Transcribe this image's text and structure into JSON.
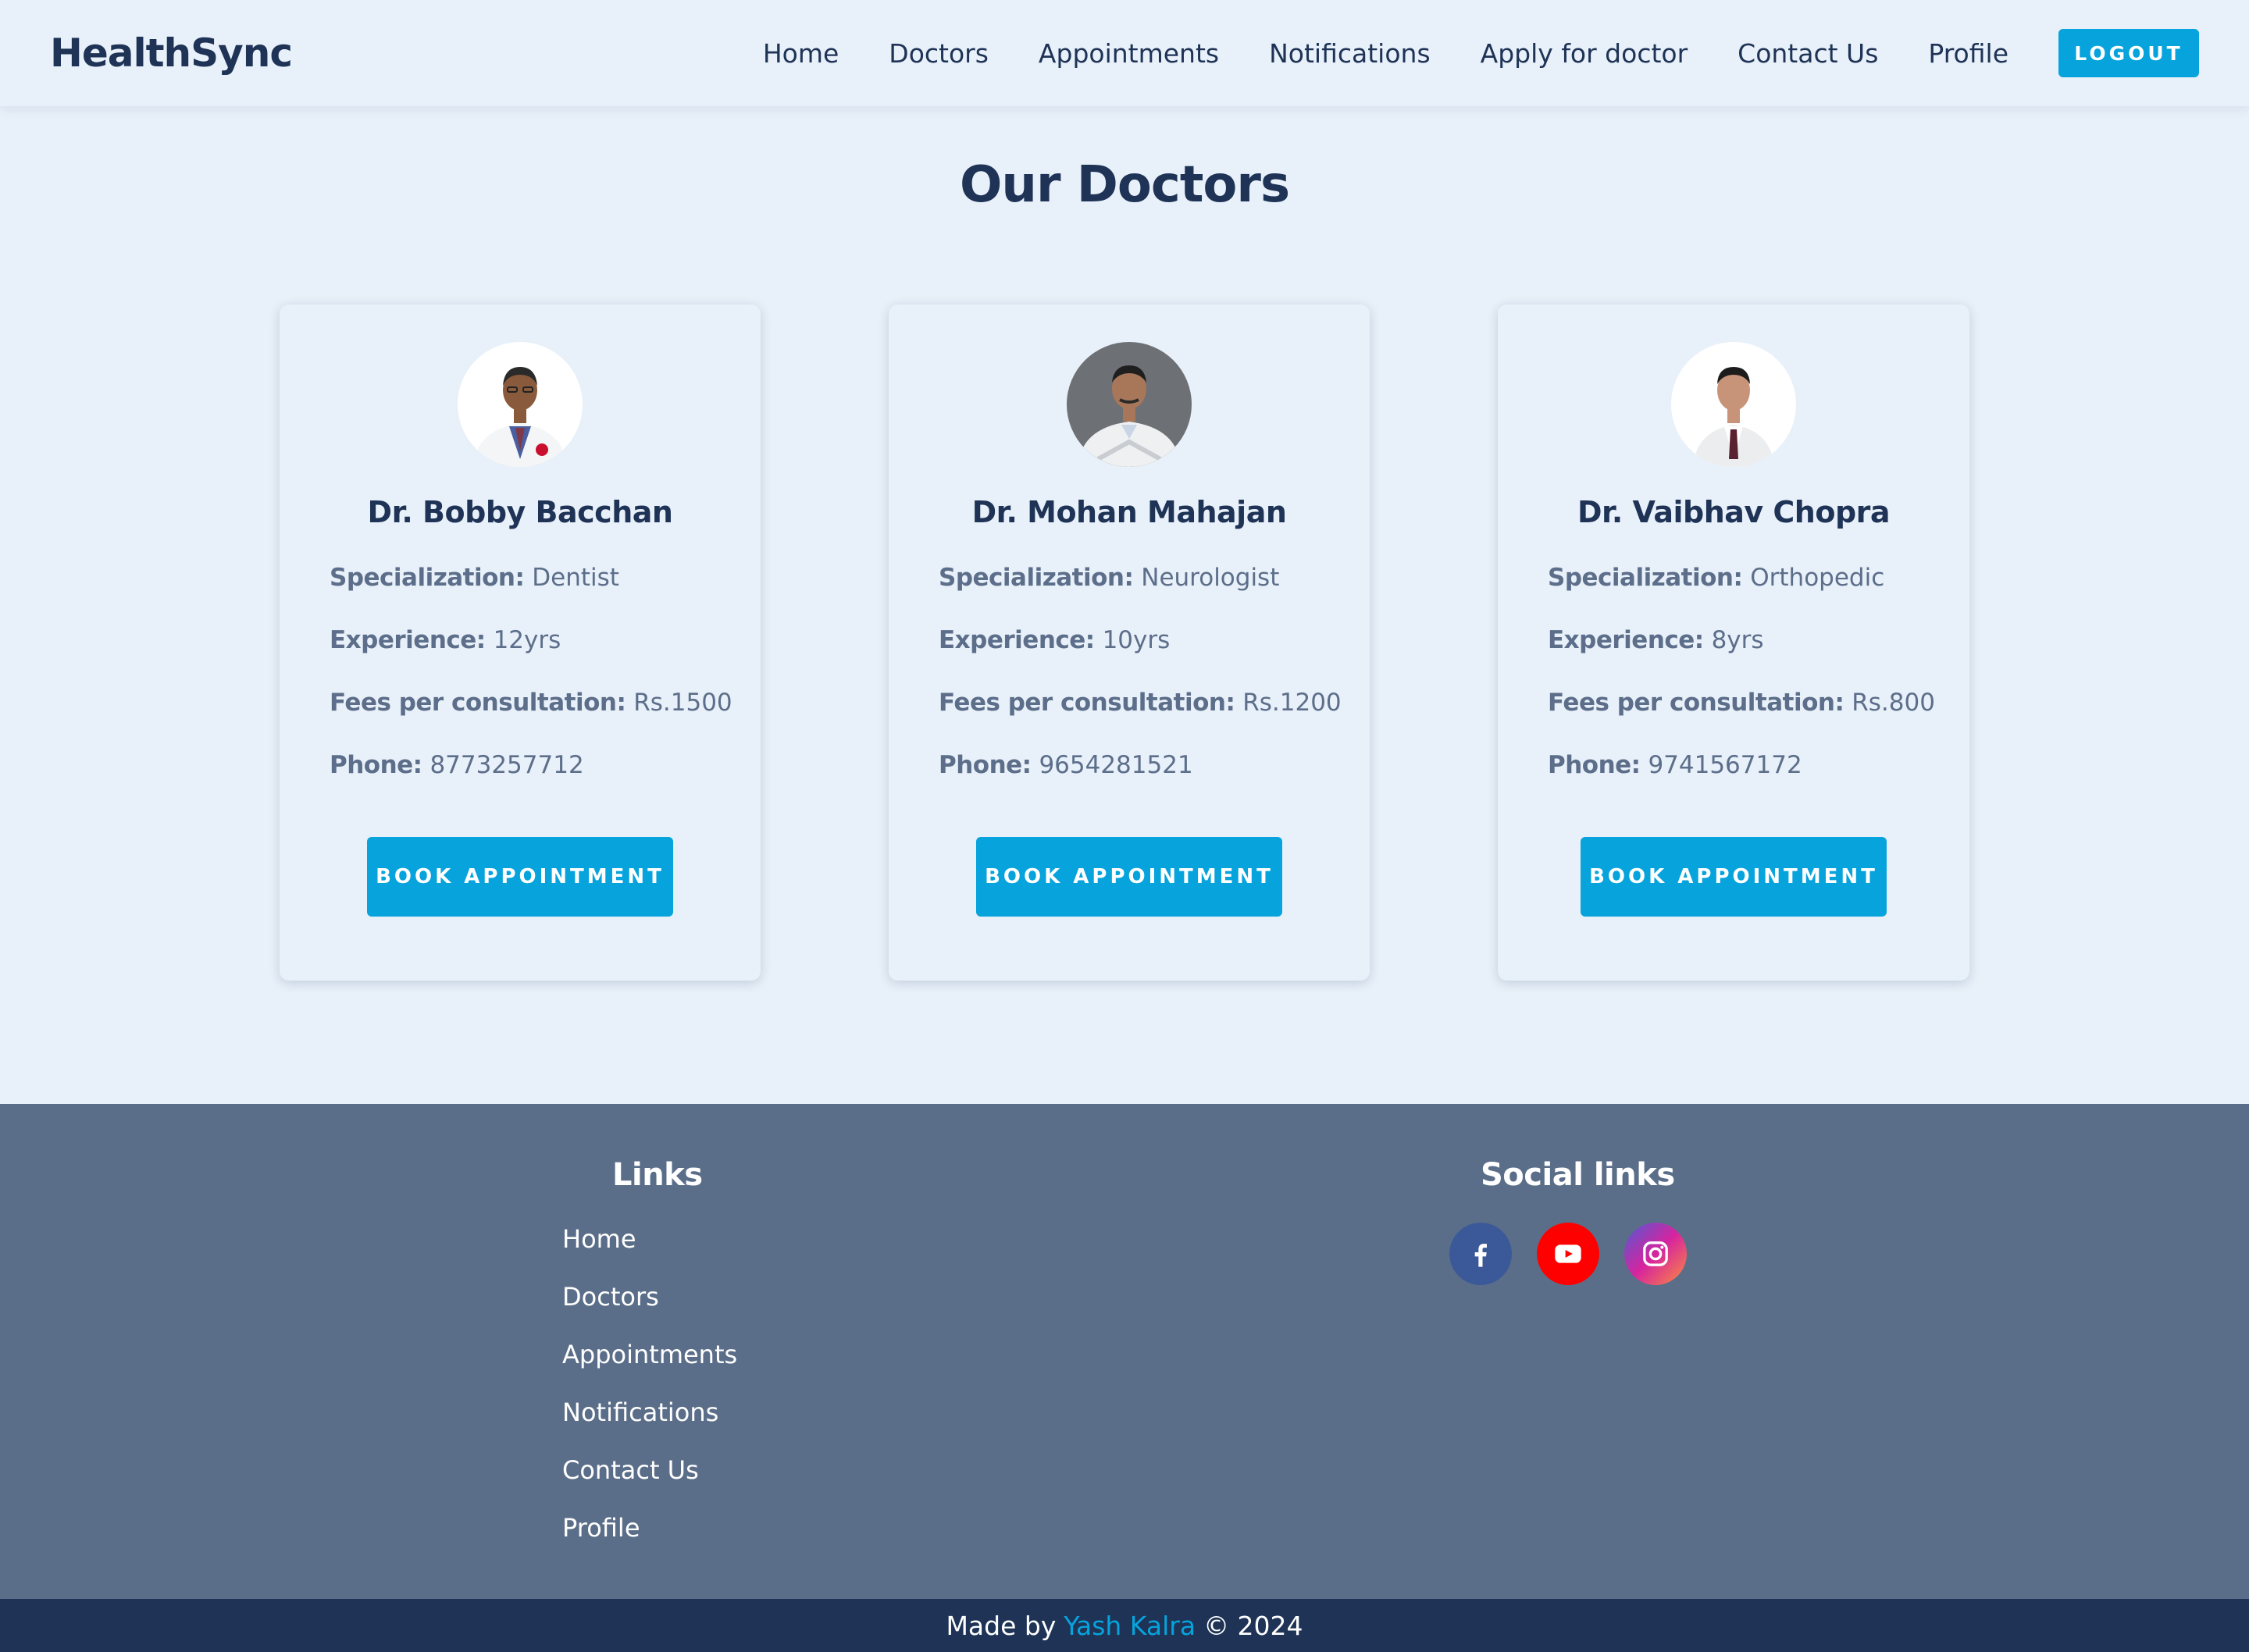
{
  "header": {
    "brand": "HealthSync",
    "nav": [
      "Home",
      "Doctors",
      "Appointments",
      "Notifications",
      "Apply for doctor",
      "Contact Us",
      "Profile"
    ],
    "logout_label": "LOGOUT"
  },
  "main": {
    "title": "Our Doctors",
    "labels": {
      "specialization": "Specialization:",
      "experience": "Experience:",
      "fees": "Fees per consultation:",
      "phone": "Phone:"
    },
    "book_label": "BOOK APPOINTMENT",
    "doctors": [
      {
        "name": "Dr. Bobby Bacchan",
        "specialization": "Dentist",
        "experience": "12yrs",
        "fees": "Rs.1500",
        "phone": "8773257712"
      },
      {
        "name": "Dr. Mohan Mahajan",
        "specialization": "Neurologist",
        "experience": "10yrs",
        "fees": "Rs.1200",
        "phone": "9654281521"
      },
      {
        "name": "Dr. Vaibhav Chopra",
        "specialization": "Orthopedic",
        "experience": "8yrs",
        "fees": "Rs.800",
        "phone": "9741567172"
      }
    ]
  },
  "footer": {
    "links_heading": "Links",
    "links": [
      "Home",
      "Doctors",
      "Appointments",
      "Notifications",
      "Contact Us",
      "Profile"
    ],
    "social_heading": "Social links",
    "social": [
      {
        "icon": "facebook-icon",
        "color": "#3b5998"
      },
      {
        "icon": "youtube-icon",
        "color": "#ff0000"
      },
      {
        "icon": "instagram-icon",
        "color": "#d6249f"
      }
    ]
  },
  "copyright": {
    "prefix": "Made by",
    "author": "Yash Kalra",
    "suffix": "© 2024"
  },
  "colors": {
    "accent": "#06a3dc",
    "primary": "#1e3356",
    "background": "#e8f0f9",
    "footer": "#5b6e89"
  }
}
